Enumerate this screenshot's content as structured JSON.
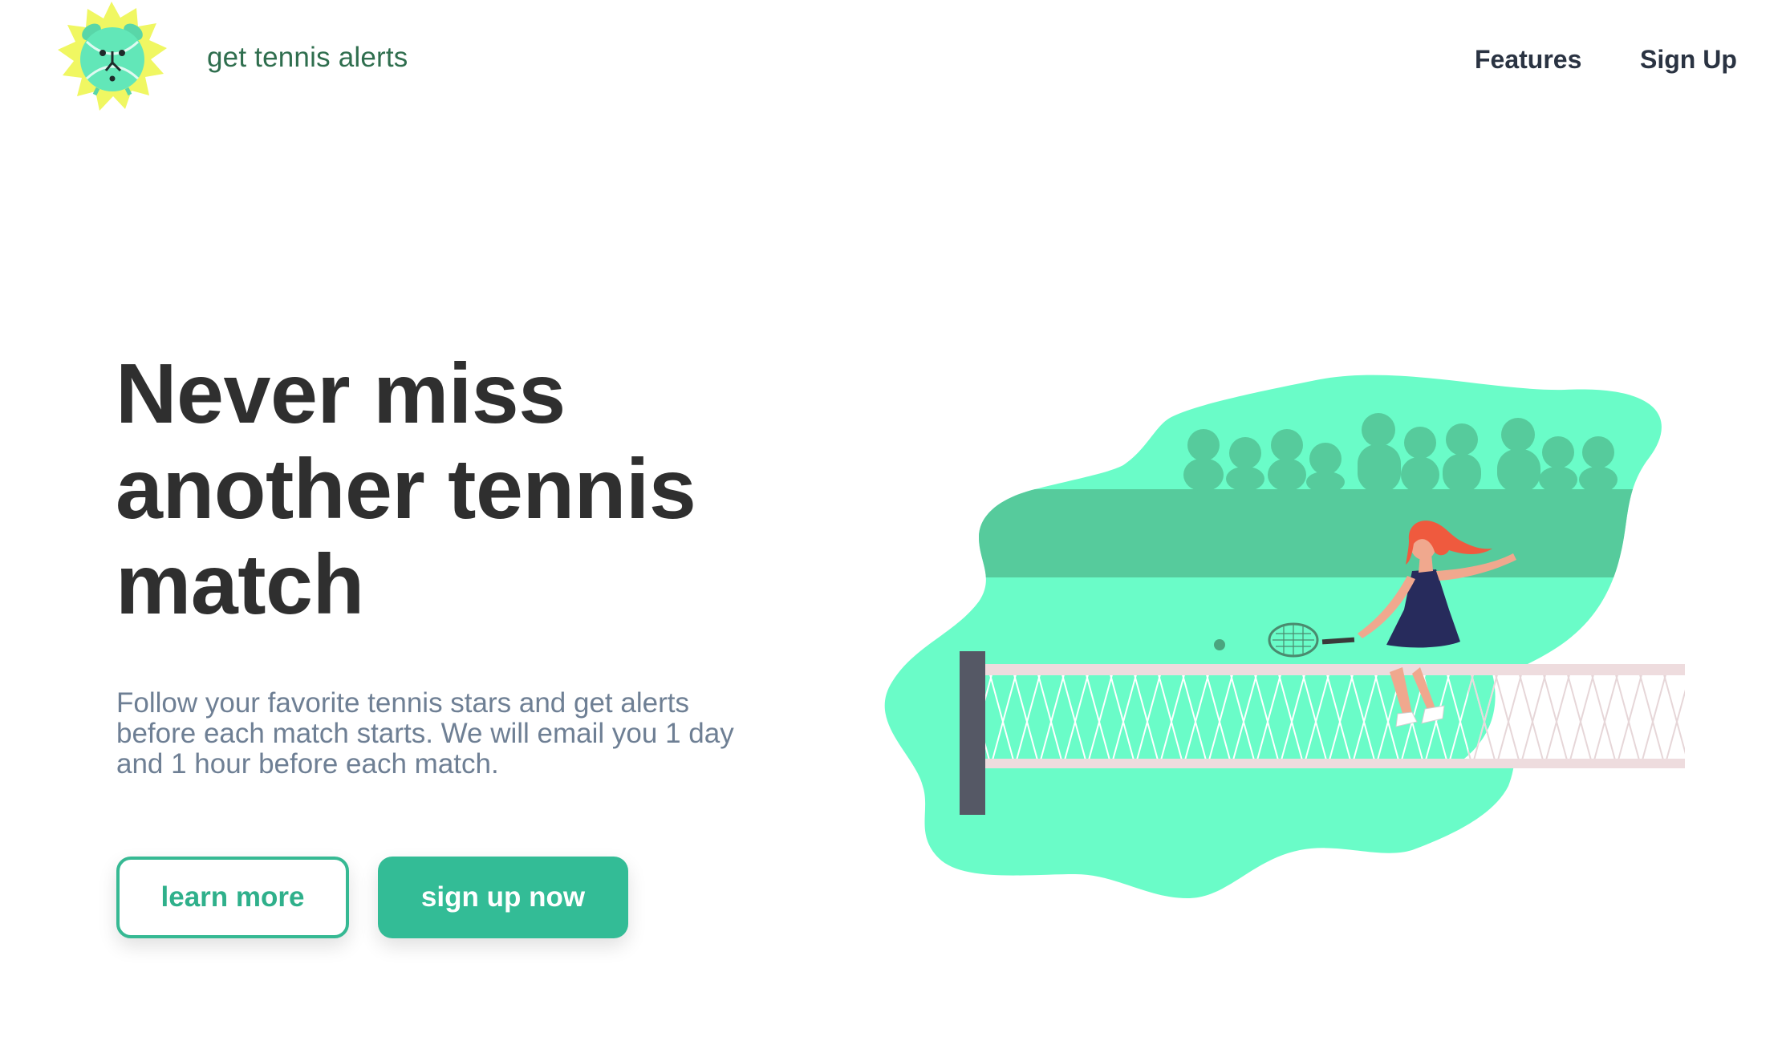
{
  "header": {
    "brand": "get tennis alerts",
    "logo_icon": "alarm-clock-tennis-ball-logo",
    "nav": {
      "features_label": "Features",
      "signup_label": "Sign Up"
    }
  },
  "hero": {
    "title": "Never miss another tennis match",
    "subtitle": "Follow your favorite tennis stars and get alerts before each match starts. We will email you 1 day and 1 hour before each match.",
    "buttons": {
      "learn_more": "learn more",
      "sign_up_now": "sign up now"
    },
    "illustration_icon": "tennis-player-illustration"
  },
  "colors": {
    "brand_text": "#2f6e4e",
    "accent": "#33bc96",
    "illustration_light": "#6afcc8",
    "illustration_dark": "#56cb9c",
    "heading": "#2f2f2f",
    "subtitle": "#6e7f94"
  }
}
